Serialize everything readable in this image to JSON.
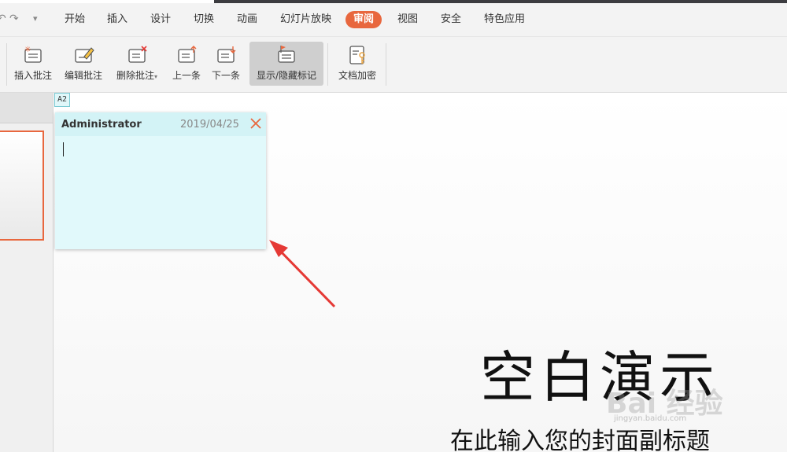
{
  "menu": {
    "items": [
      {
        "label": "开始",
        "active": false
      },
      {
        "label": "插入",
        "active": false
      },
      {
        "label": "设计",
        "active": false
      },
      {
        "label": "切换",
        "active": false
      },
      {
        "label": "动画",
        "active": false
      },
      {
        "label": "幻灯片放映",
        "active": false
      },
      {
        "label": "审阅",
        "active": true
      },
      {
        "label": "视图",
        "active": false
      },
      {
        "label": "安全",
        "active": false
      },
      {
        "label": "特色应用",
        "active": false
      }
    ]
  },
  "ribbon": {
    "buttons": [
      {
        "label": "插入批注",
        "icon": "insert-comment-icon"
      },
      {
        "label": "编辑批注",
        "icon": "edit-comment-icon"
      },
      {
        "label": "删除批注",
        "icon": "delete-comment-icon",
        "dropdown": "▾"
      },
      {
        "label": "上一条",
        "icon": "previous-comment-icon"
      },
      {
        "label": "下一条",
        "icon": "next-comment-icon"
      },
      {
        "label": "显示/隐藏标记",
        "icon": "show-hide-markup-icon",
        "pressed": true
      },
      {
        "label": "文档加密",
        "icon": "encrypt-document-icon"
      }
    ]
  },
  "comment": {
    "tag": "A2",
    "author": "Administrator",
    "date": "2019/04/25",
    "text": ""
  },
  "slide": {
    "title": "空白演示",
    "subtitle": "在此输入您的封面副标题"
  },
  "watermark": {
    "text": "Bai 经验",
    "url": "jingyan.baidu.com"
  },
  "colors": {
    "accent": "#e8673e",
    "comment_bg": "#e1f9fb",
    "annotation_arrow": "#e53935"
  }
}
